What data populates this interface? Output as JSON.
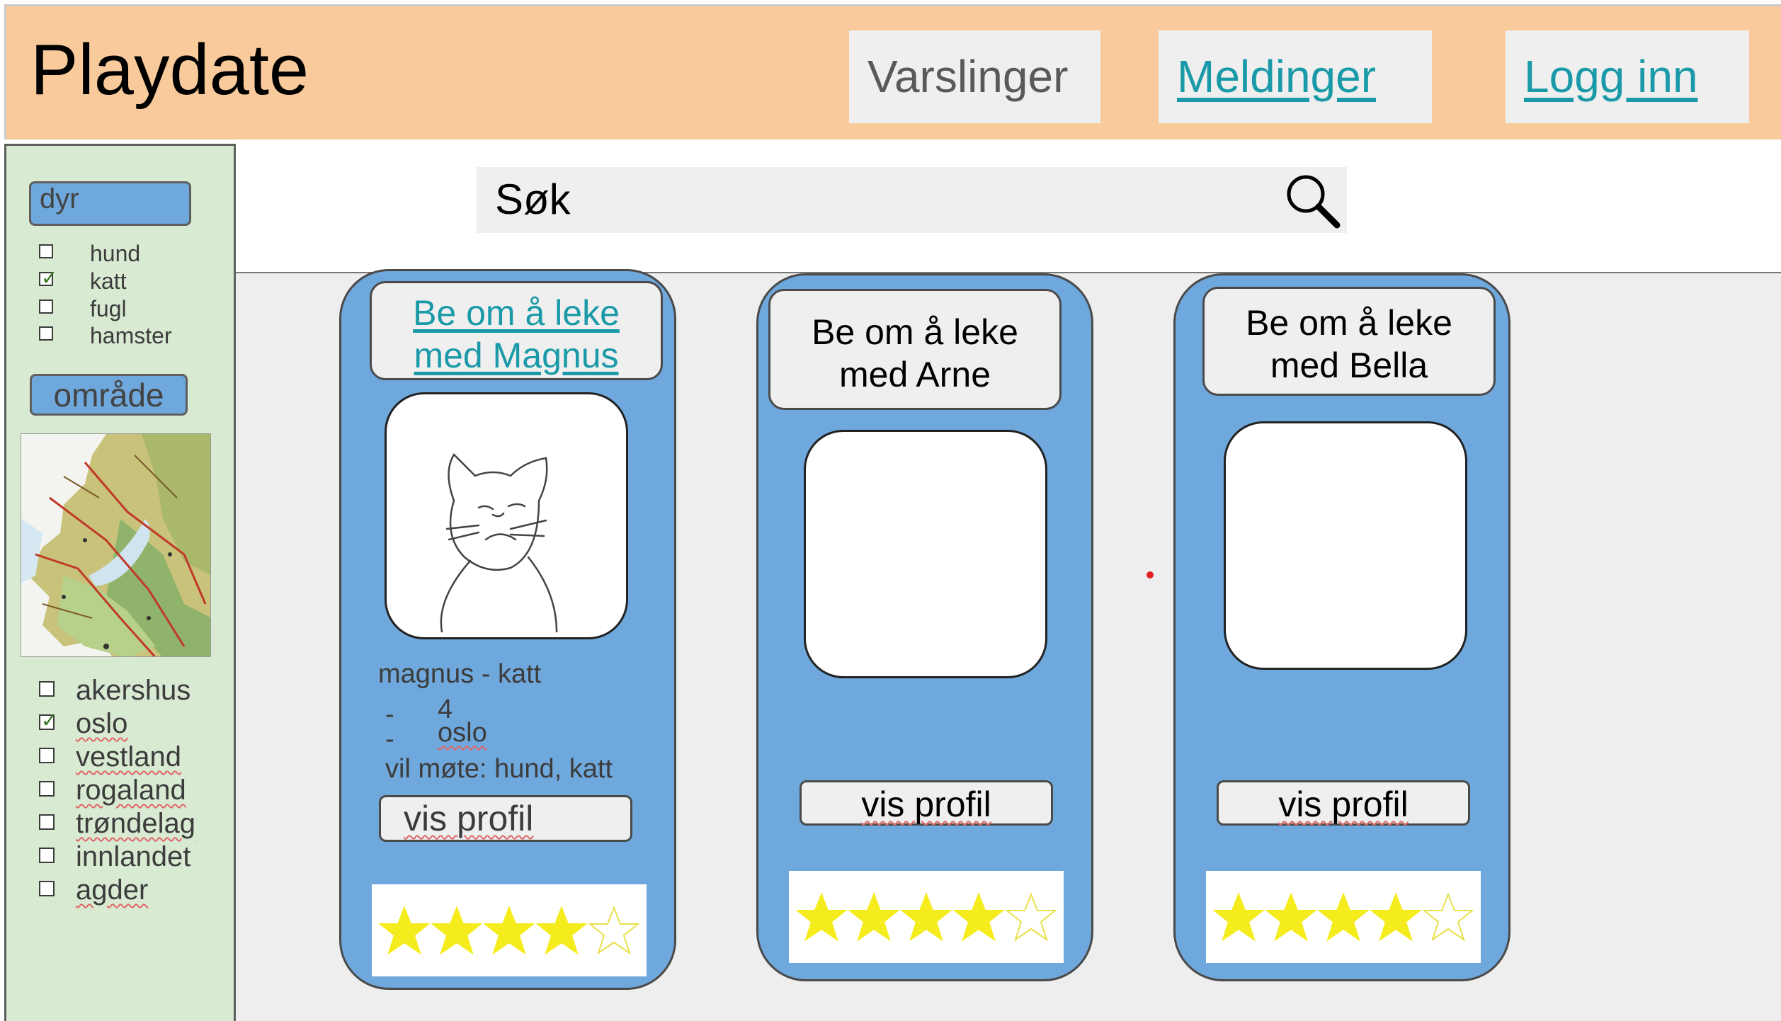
{
  "header": {
    "title": "Playdate",
    "buttons": {
      "varslinger": "Varslinger",
      "meldinger": "Meldinger",
      "logg_inn": "Logg inn"
    },
    "background_color": "#f9cb9c"
  },
  "sidebar": {
    "animal_filter": {
      "label": "dyr",
      "options": [
        {
          "label": "hund",
          "checked": false
        },
        {
          "label": "katt",
          "checked": true
        },
        {
          "label": "fugl",
          "checked": false
        },
        {
          "label": "hamster",
          "checked": false
        }
      ]
    },
    "area_filter": {
      "label": "område",
      "options": [
        {
          "label": "akershus",
          "checked": false
        },
        {
          "label": "oslo",
          "checked": true
        },
        {
          "label": "vestland",
          "checked": false
        },
        {
          "label": "rogaland",
          "checked": false
        },
        {
          "label": "trøndelag",
          "checked": false
        },
        {
          "label": "innlandet",
          "checked": false
        },
        {
          "label": "agder",
          "checked": false
        }
      ]
    },
    "map_icon": "region-map-icon"
  },
  "search": {
    "placeholder": "Søk",
    "icon": "search-icon"
  },
  "cards": [
    {
      "title_line1": "Be om å leke",
      "title_line2": "med Magnus",
      "subtitle": "magnus - katt",
      "details": [
        {
          "bullet": "-",
          "text": "4"
        },
        {
          "bullet": "-",
          "text": "oslo"
        }
      ],
      "wants_to_meet": "vil møte: hund, katt",
      "profile_button": "vis profil",
      "rating": 4,
      "max_rating": 5
    },
    {
      "title_line1": "Be om å leke",
      "title_line2": "med Arne",
      "profile_button": "vis profil",
      "rating": 4,
      "max_rating": 5
    },
    {
      "title_line1": "Be om å leke",
      "title_line2": "med Bella",
      "profile_button": "vis profil",
      "rating": 4,
      "max_rating": 5
    }
  ],
  "colors": {
    "card": "#6fa8dc",
    "sidebar": "#d9ead3",
    "link": "#1a9aa8",
    "star": "#f5ec1e"
  }
}
